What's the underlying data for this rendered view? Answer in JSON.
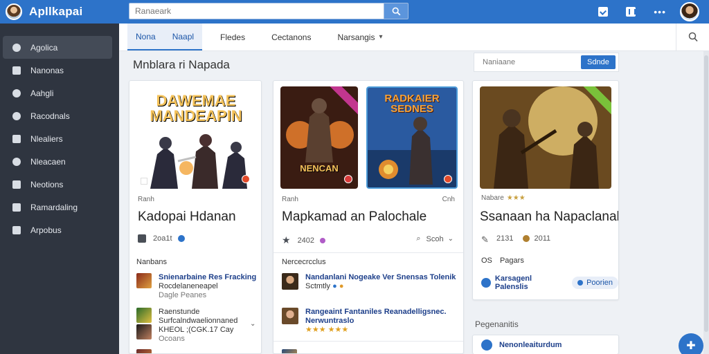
{
  "app": {
    "title": "Apllkapai"
  },
  "search": {
    "placeholder": "Ranaeark"
  },
  "sidebar": {
    "items": [
      {
        "label": "Agolica",
        "icon": "gamepad-icon"
      },
      {
        "label": "Nanonas",
        "icon": "home-icon"
      },
      {
        "label": "Aahgli",
        "icon": "chat-icon"
      },
      {
        "label": "Racodnals",
        "icon": "record-icon"
      },
      {
        "label": "Nlealiers",
        "icon": "image-icon"
      },
      {
        "label": "Nleacaen",
        "icon": "compass-icon"
      },
      {
        "label": "Neotions",
        "icon": "mail-icon"
      },
      {
        "label": "Ramardaling",
        "icon": "list-icon"
      },
      {
        "label": "Arpobus",
        "icon": "play-icon"
      }
    ]
  },
  "tabs": [
    {
      "label": "Nona"
    },
    {
      "label": "Naapl"
    },
    {
      "label": "Fledes"
    },
    {
      "label": "Cectanons"
    },
    {
      "label": "Narsangis"
    }
  ],
  "content": {
    "title": "Mnblara ri Napada",
    "mini_search": {
      "placeholder": "Naniaane",
      "button": "Sdnde"
    }
  },
  "cards": [
    {
      "covers": [
        {
          "title": "DAWEMAE MANDEAPIN",
          "colors": [
            "#3a1c1a",
            "#c8502a",
            "#f2a43a"
          ]
        }
      ],
      "meta_top": "Ranh",
      "title": "Kadopai Hdanan",
      "stats": {
        "count": "2oa1t"
      },
      "section_label": "Nanbans",
      "list": [
        {
          "l1": "Snienarbaine Res Fracking",
          "l2": "Rocdelaneneapel",
          "l3": "Dagle Peanes"
        },
        {
          "l1": "Raenstunde",
          "l2": "Surfcalndwaelionnaned",
          "l3": "KHEOL ;(CGK.17 Cay"
        },
        {
          "l1": "",
          "l2": "",
          "l3": "Ocoans"
        }
      ]
    },
    {
      "covers": [
        {
          "title": "NENCAN",
          "colors": [
            "#2a1410",
            "#8a3c1c",
            "#e07a2c"
          ]
        },
        {
          "title": "RADKAIER SEDNES",
          "colors": [
            "#163a7a",
            "#3e78c0",
            "#e08c2e"
          ]
        }
      ],
      "meta_top": "Ranh",
      "meta_right": "Cnh",
      "title": "Mapkamad an Palochale",
      "stats": {
        "count": "2402",
        "right": "Scoh"
      },
      "section_label": "Nercecrcclus",
      "list": [
        {
          "l1": "Nandanlani Nogeake Ver Snensas Tolenik",
          "l2": "Sctmtly"
        },
        {
          "l1": "Rangeaint Fantaniles Reanadelligsnec.",
          "l2": "Nerwuntraslo"
        }
      ]
    },
    {
      "covers": [
        {
          "title": "",
          "colors": [
            "#3b2614",
            "#a0641e",
            "#f0d07a"
          ]
        }
      ],
      "meta_top": "Nabare",
      "title": "Ssanaan ha Napaclanah",
      "stats": {
        "count": "2131",
        "right": "2011"
      },
      "section_label": "Pagars",
      "section_prefix": "OS",
      "footer_link": "Karsagenl Palenslis",
      "footer_tag": "Poorien"
    }
  ],
  "side_section": {
    "label": "Pegenanitis",
    "link": "Nenonleaiturdum"
  }
}
